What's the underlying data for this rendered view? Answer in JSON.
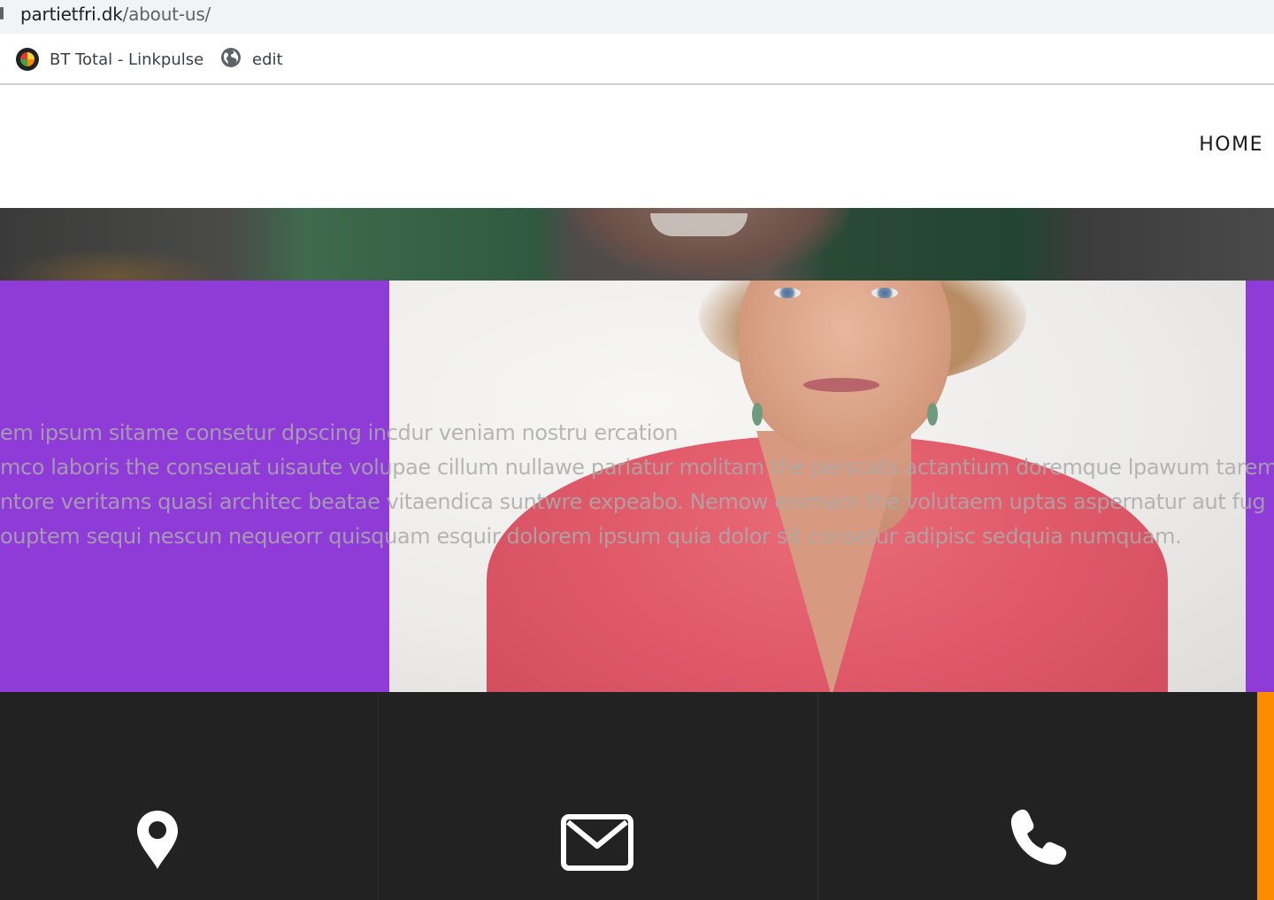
{
  "browser": {
    "url_host": "partietfri.dk",
    "url_path": "/about-us/",
    "bookmarks": [
      {
        "label": "BT Total - Linkpulse",
        "icon": "linkpulse-icon"
      },
      {
        "label": "edit",
        "icon": "globe-icon"
      }
    ]
  },
  "site": {
    "nav": {
      "home_label": "HOME"
    }
  },
  "about": {
    "lines": [
      "em ipsum sitame consetur dpscing incdur veniam nostru ercation",
      "mco laboris the conseuat uisaute volupae cillum nullawe pariatur molitam the perscats actantium doremque lpawum tarem",
      "ntore veritams quasi architec beatae vitaendica suntwre expeabo. Nemow enimam the volutaem uptas aspernatur aut fug",
      "ouptem sequi nescun nequeorr quisquam esquir dolorem ipsum quia dolor sit consetur adipisc sedquia numquam."
    ],
    "background_color": "#8f3bd8"
  },
  "contact": {
    "icons": [
      "map-pin-icon",
      "envelope-icon",
      "phone-icon"
    ],
    "background_color": "#222222",
    "accent_color": "#ff8c00"
  }
}
